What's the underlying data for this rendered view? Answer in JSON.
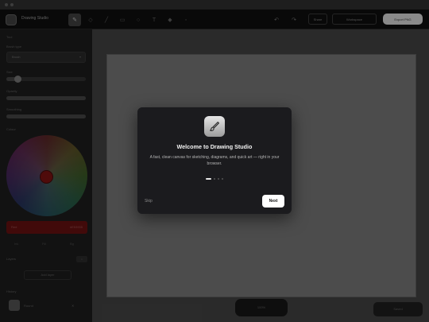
{
  "header": {
    "app_title": "Drawing Studio",
    "share_label": "Share",
    "workspace_label": "Workspace",
    "export_label": "Export PNG"
  },
  "sidebar": {
    "section_label": "Tool",
    "brush_label": "Brush type",
    "brush_value": "Brush",
    "size_label": "Size",
    "size_value": "8",
    "size_level": 0.14,
    "opacity_label": "Opacity",
    "opacity_value": "100",
    "opacity_level": 1.0,
    "smoothing_label": "Smoothing",
    "smoothing_value": "50",
    "smoothing_level": 1.0,
    "color_label": "Colour",
    "color_name": "Red",
    "color_hex": "#E53935",
    "swatch_labels": [
      "Ink",
      "Fill",
      "Bg"
    ],
    "layers_label": "Layers",
    "layers_count": "1",
    "add_layer_label": "Add layer",
    "history_label": "History",
    "brush_preview_label": "Round"
  },
  "canvas": {
    "zoom_label": "100%",
    "status_label": "Saved"
  },
  "modal": {
    "title": "Welcome to Drawing Studio",
    "body": "A fast, clean canvas for sketching, diagrams, and quick art — right in your browser.",
    "skip_label": "Skip",
    "next_label": "Next",
    "step_total": 4,
    "step_current": 1
  },
  "colors": {
    "accent": "#ffffff",
    "modal_bg": "#1b1b1e",
    "selected_color": "#e53935"
  },
  "icons": {
    "modal_icon": "paintbrush-icon"
  }
}
